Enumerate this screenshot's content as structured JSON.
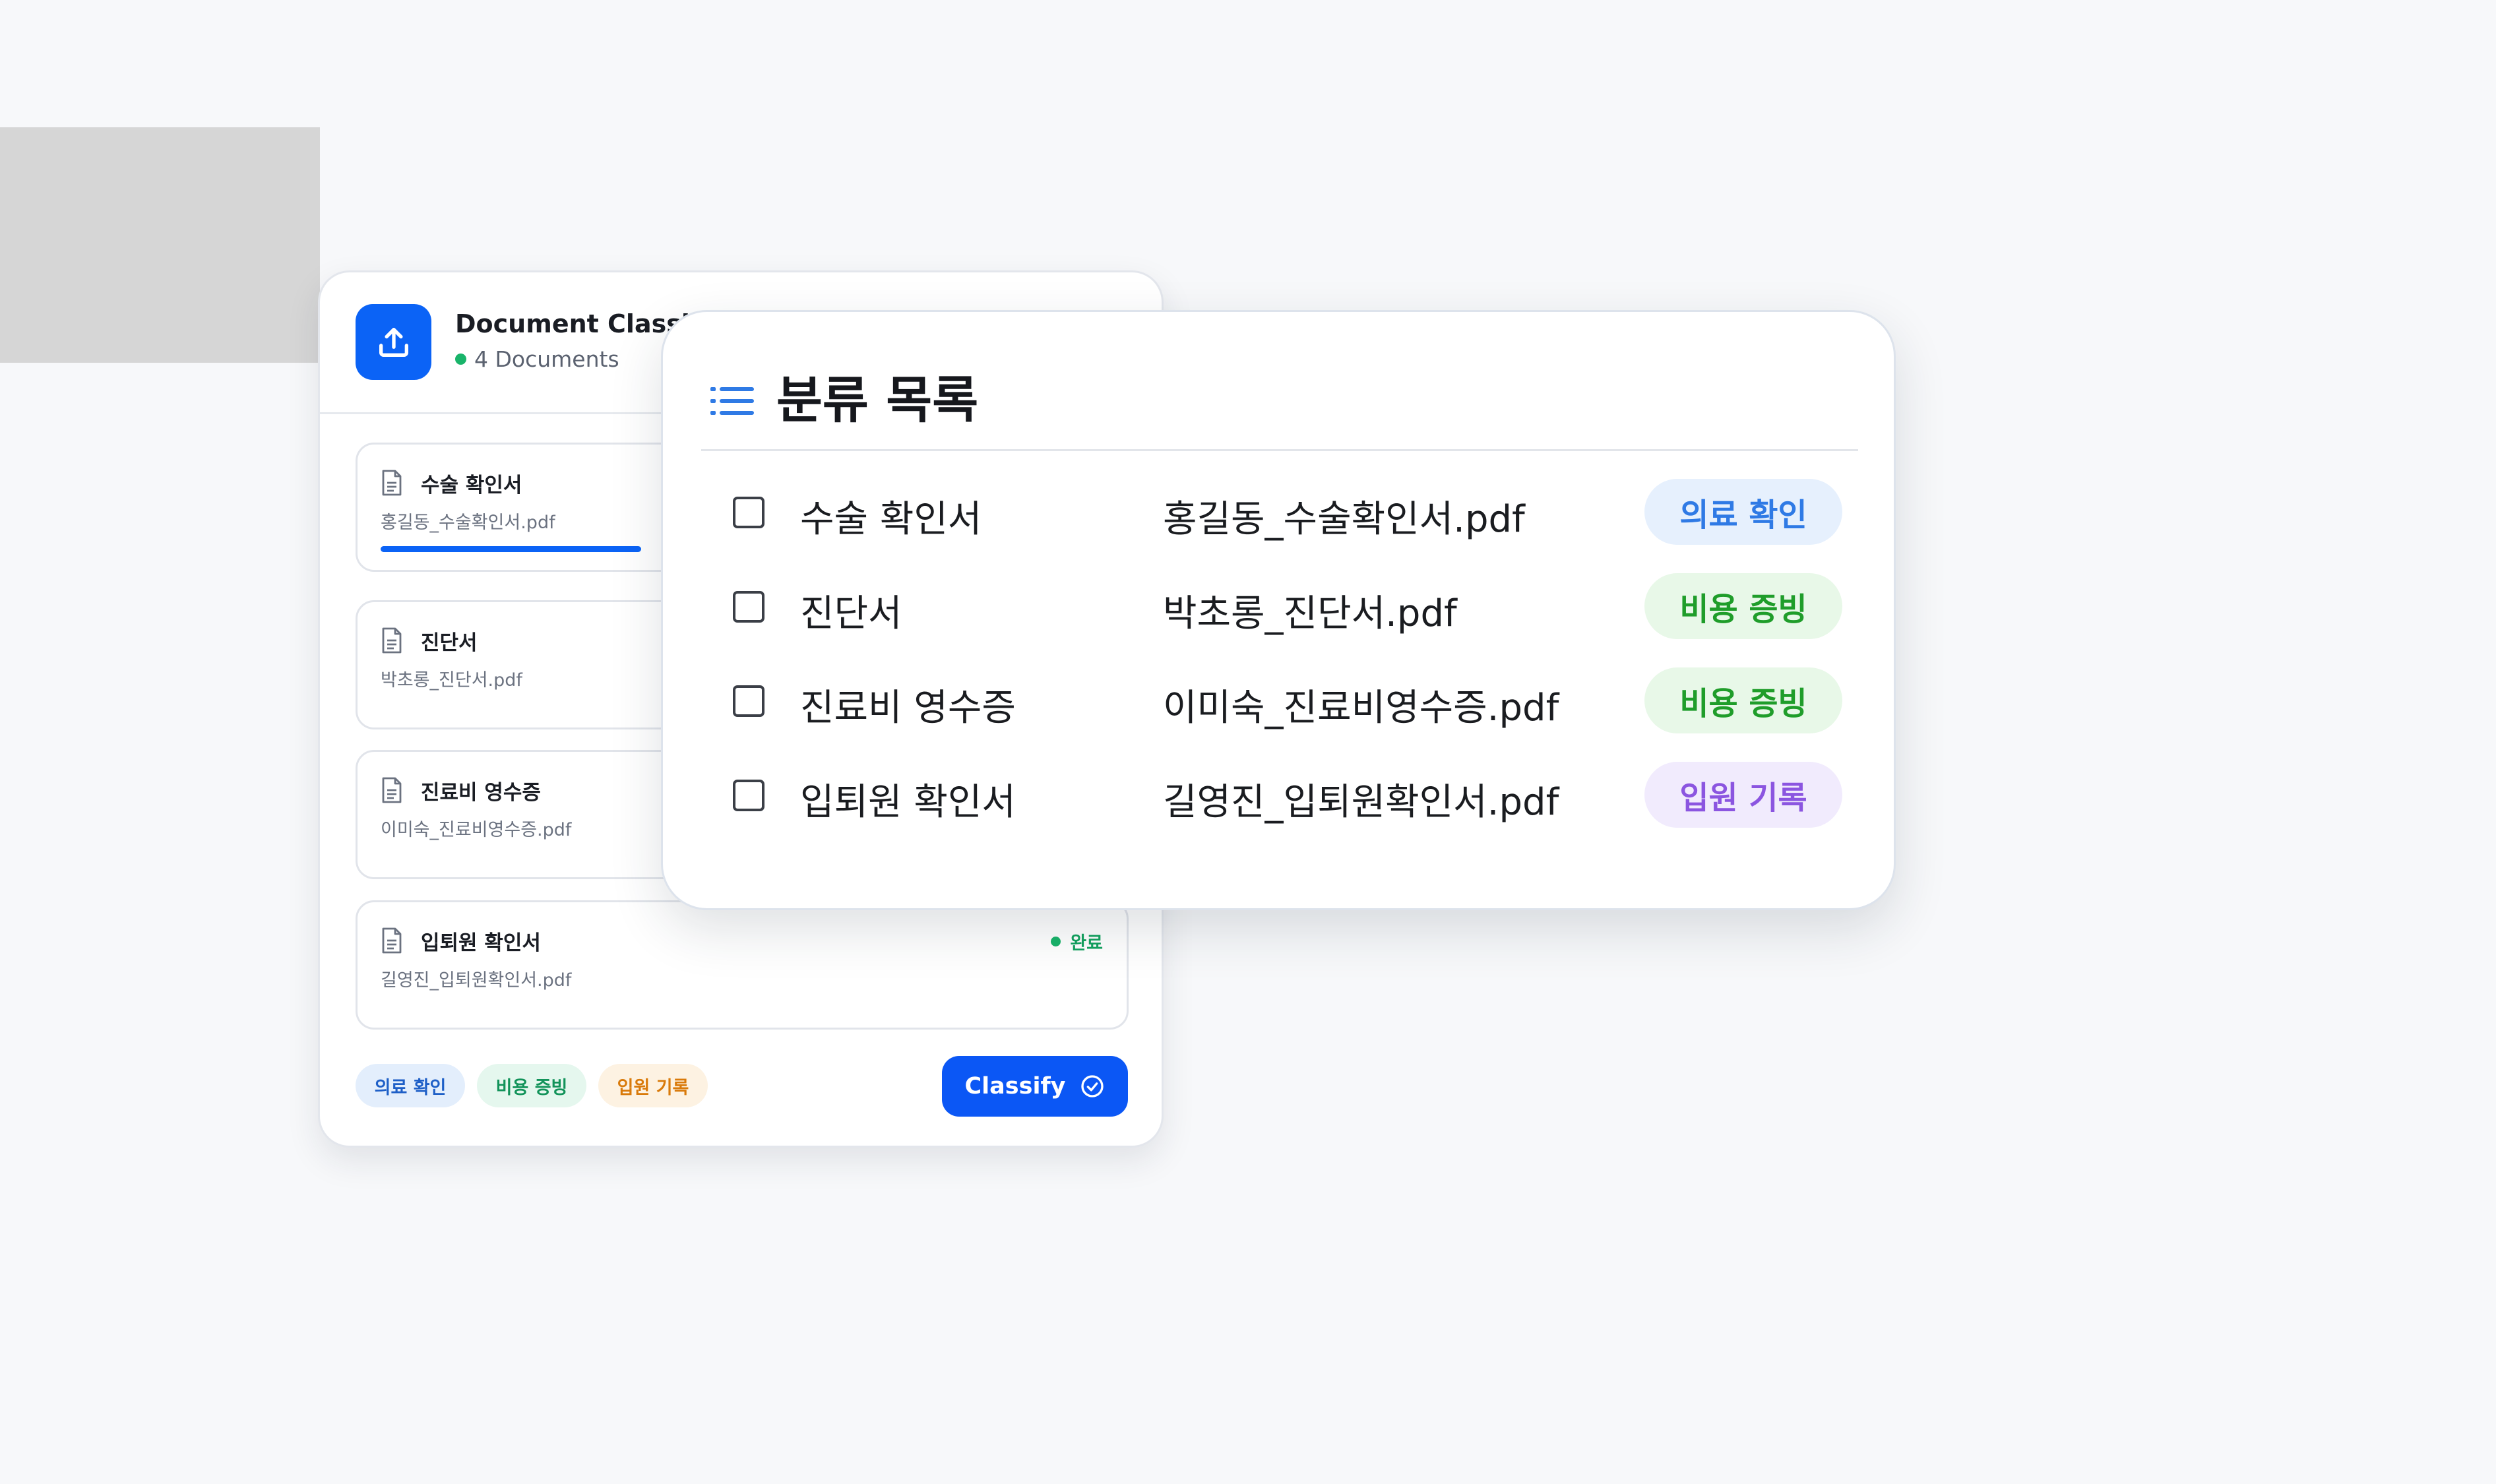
{
  "back_panel": {
    "title": "Document Classifi",
    "subtitle": "4 Documents",
    "documents": [
      {
        "name": "수술 확인서",
        "file": "홍길동_수술확인서.pdf",
        "status": "",
        "progress": 0.36
      },
      {
        "name": "진단서",
        "file": "박초롱_진단서.pdf",
        "status": ""
      },
      {
        "name": "진료비 영수증",
        "file": "이미숙_진료비영수증.pdf",
        "status": ""
      },
      {
        "name": "입퇴원 확인서",
        "file": "길영진_입퇴원확인서.pdf",
        "status": "완료"
      }
    ],
    "tags": [
      "의료 확인",
      "비용 증빙",
      "입원 기록"
    ],
    "classify_label": "Classify"
  },
  "front_panel": {
    "title": "분류 목록",
    "rows": [
      {
        "name": "수술 확인서",
        "file": "홍길동_수술확인서.pdf",
        "tag": "의료 확인",
        "tag_color": "#2f7ae5",
        "tag_bg": "#e6f0fd"
      },
      {
        "name": "진단서",
        "file": "박초롱_진단서.pdf",
        "tag": "비용 증빙",
        "tag_color": "#1f9d2a",
        "tag_bg": "#e8f8e8"
      },
      {
        "name": "진료비 영수증",
        "file": "이미숙_진료비영수증.pdf",
        "tag": "비용 증빙",
        "tag_color": "#1f9d2a",
        "tag_bg": "#e8f8e8"
      },
      {
        "name": "입퇴원 확인서",
        "file": "길영진_입퇴원확인서.pdf",
        "tag": "입원 기록",
        "tag_color": "#8b55e0",
        "tag_bg": "#f1ebfd"
      }
    ]
  },
  "colors": {
    "primary": "#0b57f5",
    "success": "#19b46a",
    "tag_medical": "#2f7ae5",
    "tag_cost": "#1f9d2a",
    "tag_admission": "#8b55e0"
  },
  "icons": [
    "upload-icon",
    "document-icon",
    "list-icon",
    "check-circle-icon"
  ]
}
